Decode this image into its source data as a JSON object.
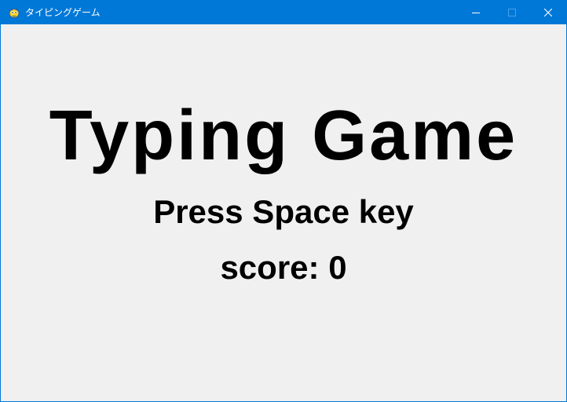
{
  "window": {
    "title": "タイピングゲーム",
    "icon": "pygame-snake-icon",
    "colors": {
      "titlebar": "#0078d7",
      "background": "#f0f0f0",
      "text": "#000000"
    },
    "controls": {
      "minimize_icon": "minimize-icon",
      "maximize_icon": "maximize-icon",
      "close_icon": "close-icon"
    }
  },
  "game": {
    "title": "Typing Game",
    "prompt": "Press Space key",
    "score_label": "score:",
    "score_value": "0"
  }
}
